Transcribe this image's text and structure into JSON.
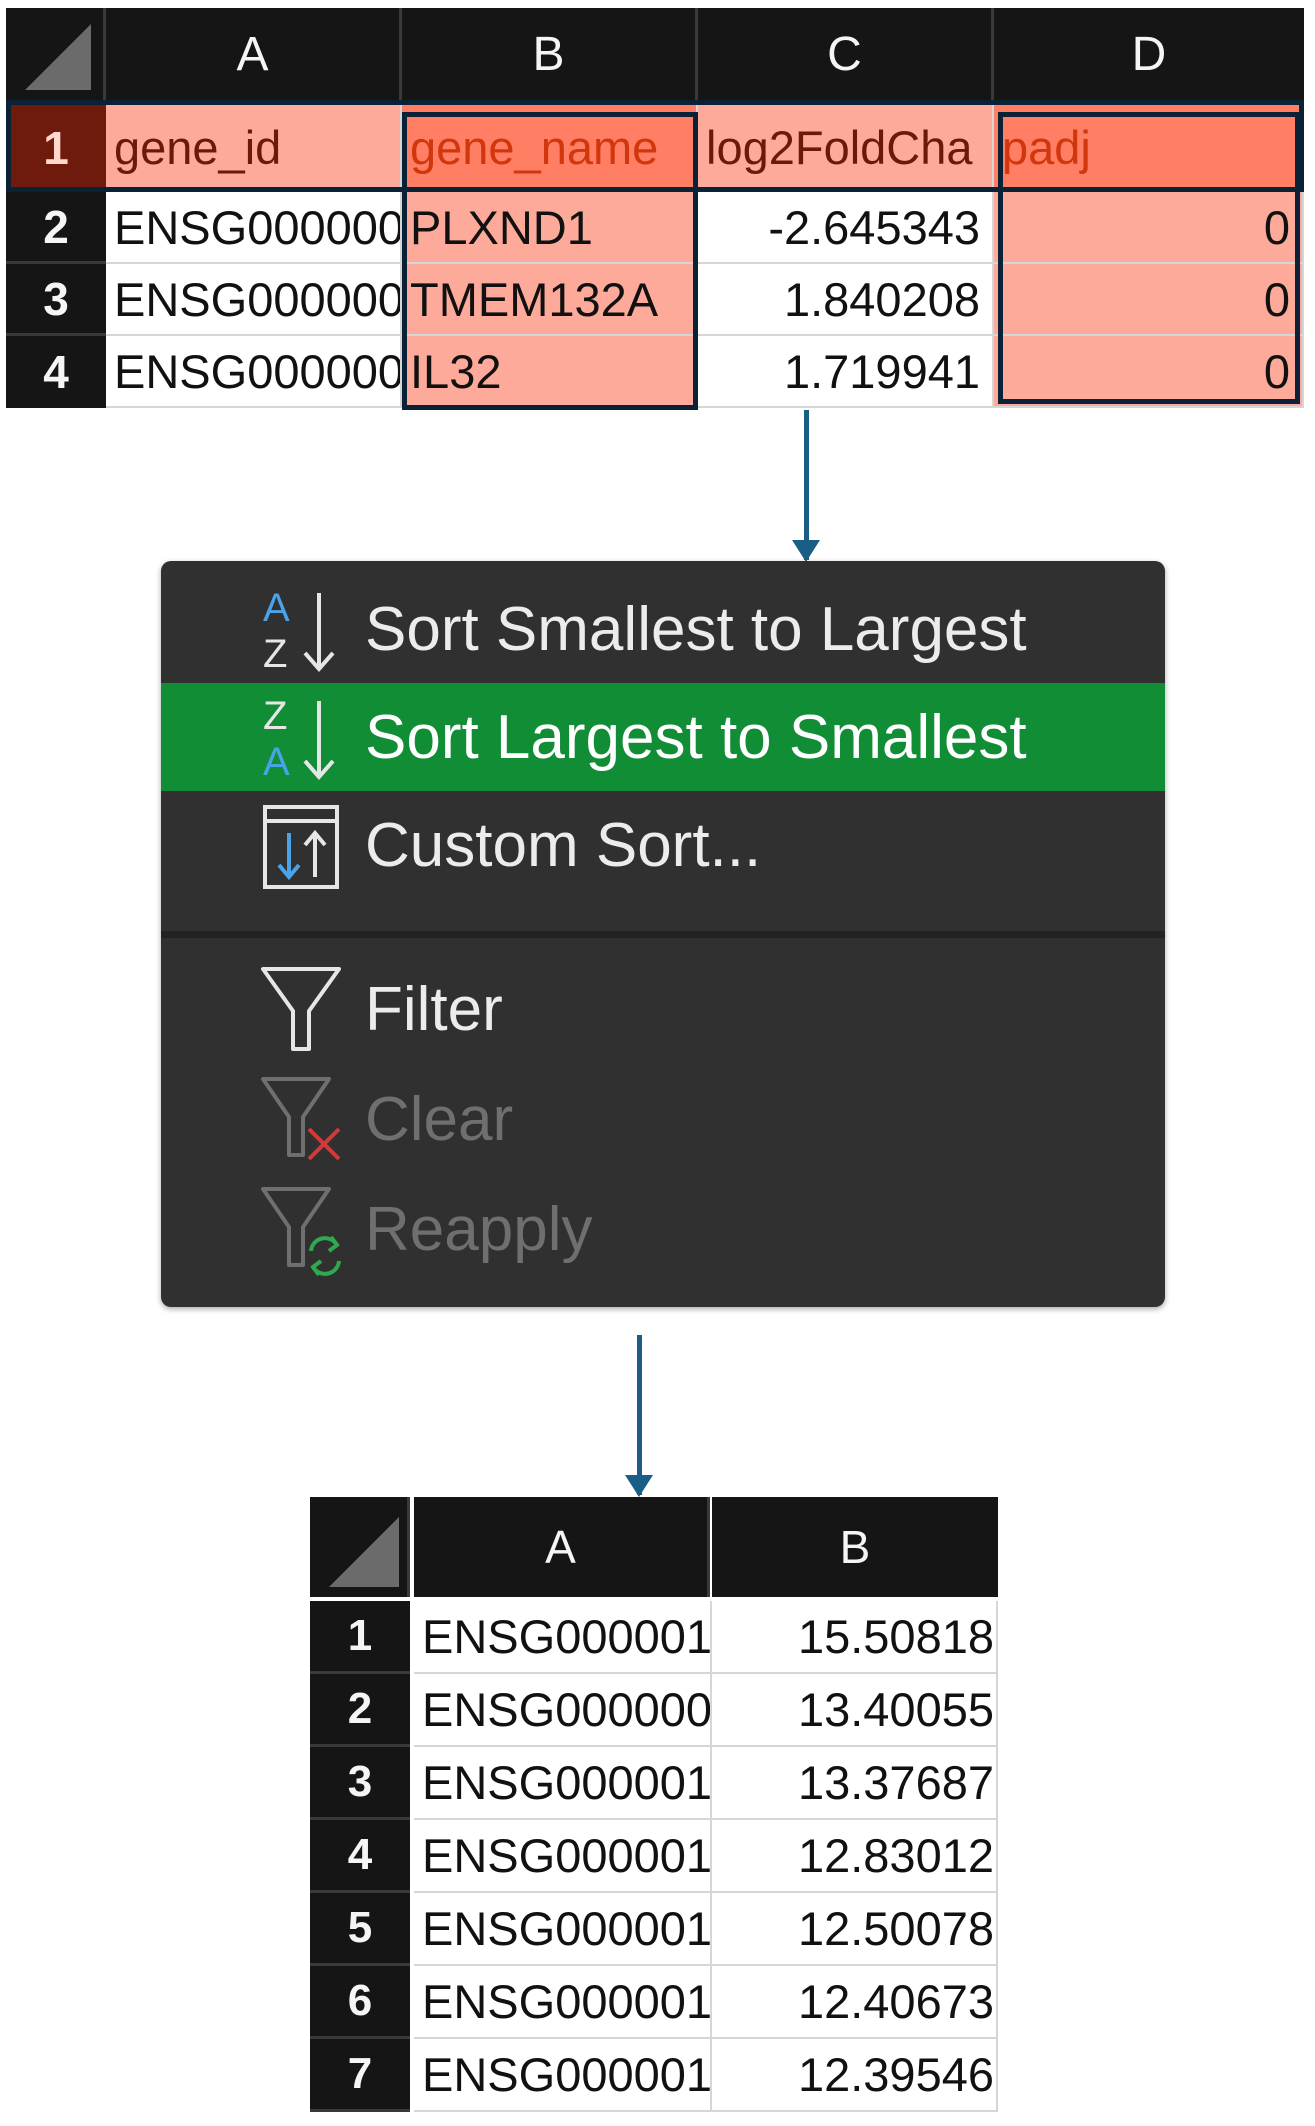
{
  "top_sheet": {
    "columns": [
      "A",
      "B",
      "C",
      "D"
    ],
    "header_row": {
      "row_number": "1",
      "cells": [
        "gene_id",
        "gene_name",
        "log2FoldCha",
        "padj"
      ]
    },
    "rows": [
      {
        "row_number": "2",
        "cells": [
          "ENSG000000",
          "PLXND1",
          "-2.645343",
          "0"
        ]
      },
      {
        "row_number": "3",
        "cells": [
          "ENSG000000",
          "TMEM132A",
          "1.840208",
          "0"
        ]
      },
      {
        "row_number": "4",
        "cells": [
          "ENSG000000",
          "IL32",
          "1.719941",
          "0"
        ]
      }
    ]
  },
  "sort_menu": {
    "items": [
      {
        "label": "Sort Smallest to Largest",
        "icon": "sort-ascending-icon",
        "state": "normal"
      },
      {
        "label": "Sort Largest to Smallest",
        "icon": "sort-descending-icon",
        "state": "highlighted"
      },
      {
        "label": "Custom Sort...",
        "icon": "custom-sort-icon",
        "state": "normal"
      },
      {
        "label": "Filter",
        "icon": "filter-icon",
        "state": "normal"
      },
      {
        "label": "Clear",
        "icon": "clear-filter-icon",
        "state": "disabled"
      },
      {
        "label": "Reapply",
        "icon": "reapply-filter-icon",
        "state": "disabled"
      }
    ],
    "highlight_color": "#118d36"
  },
  "bottom_sheet": {
    "columns": [
      "A",
      "B"
    ],
    "rows": [
      {
        "row_number": "1",
        "cells": [
          "ENSG000001",
          "15.50818"
        ]
      },
      {
        "row_number": "2",
        "cells": [
          "ENSG000000",
          "13.40055"
        ]
      },
      {
        "row_number": "3",
        "cells": [
          "ENSG000001",
          "13.37687"
        ]
      },
      {
        "row_number": "4",
        "cells": [
          "ENSG000001",
          "12.83012"
        ]
      },
      {
        "row_number": "5",
        "cells": [
          "ENSG000001",
          "12.50078"
        ]
      },
      {
        "row_number": "6",
        "cells": [
          "ENSG000001",
          "12.40673"
        ]
      },
      {
        "row_number": "7",
        "cells": [
          "ENSG000001",
          "12.39546"
        ]
      }
    ]
  },
  "colors": {
    "selection_highlight": "#fdaa9b",
    "active_header": "#ff7e64",
    "selection_border": "#0b2136",
    "arrow": "#1b5e85"
  }
}
